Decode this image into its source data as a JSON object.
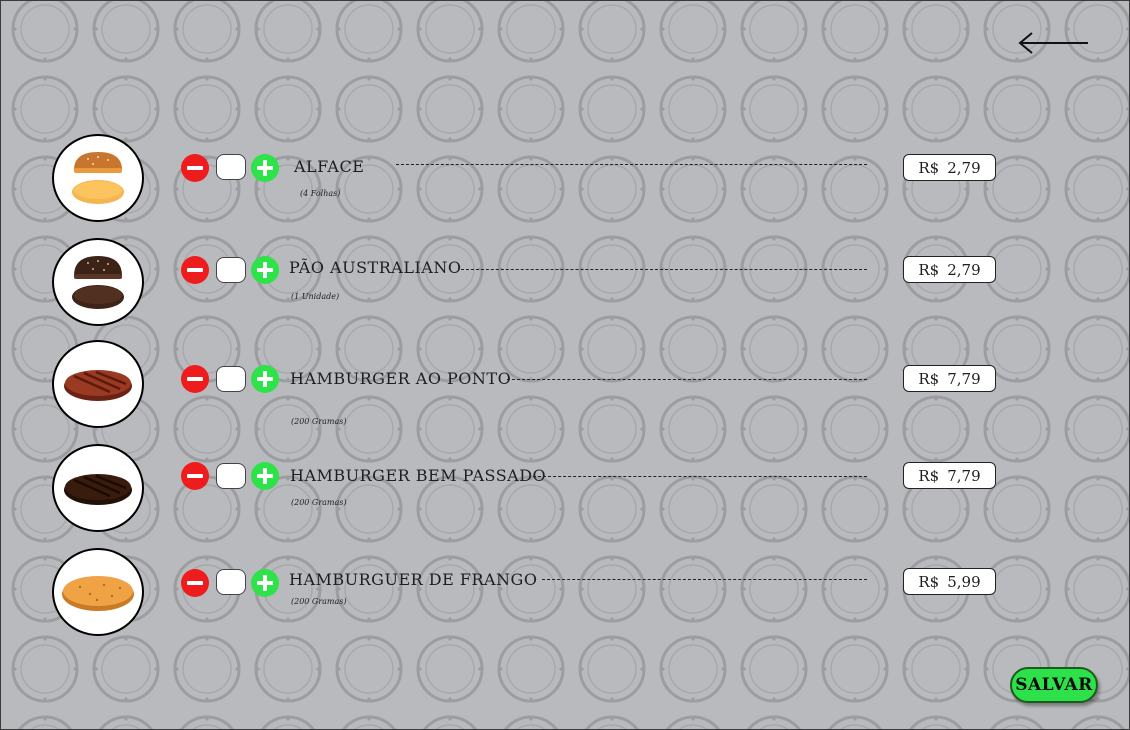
{
  "header": {
    "back_icon": "left-arrow-icon"
  },
  "items": [
    {
      "name": "ALFACE",
      "sub": "(4 Folhas)",
      "currency": "R$",
      "price": "2,79",
      "quantity": "",
      "image": "lettuce-bun-icon"
    },
    {
      "name": "PÃO AUSTRALIANO",
      "sub": "(1 Unidade)",
      "currency": "R$",
      "price": "2,79",
      "quantity": "",
      "image": "australian-bun-icon"
    },
    {
      "name": "HAMBURGER AO PONTO",
      "sub": "(200 Gramas)",
      "currency": "R$",
      "price": "7,79",
      "quantity": "",
      "image": "medium-patty-icon"
    },
    {
      "name": "HAMBURGER BEM PASSADO",
      "sub": "(200 Gramas)",
      "currency": "R$",
      "price": "7,79",
      "quantity": "",
      "image": "well-done-patty-icon"
    },
    {
      "name": "HAMBURGUER DE FRANGO",
      "sub": "(200 Gramas)",
      "currency": "R$",
      "price": "5,99",
      "quantity": "",
      "image": "chicken-patty-icon"
    }
  ],
  "footer": {
    "save_label": "SALVAR"
  },
  "colors": {
    "background": "#b9babe",
    "minus": "#ee1c1c",
    "plus": "#2ee24a",
    "save": "#2de14a"
  }
}
